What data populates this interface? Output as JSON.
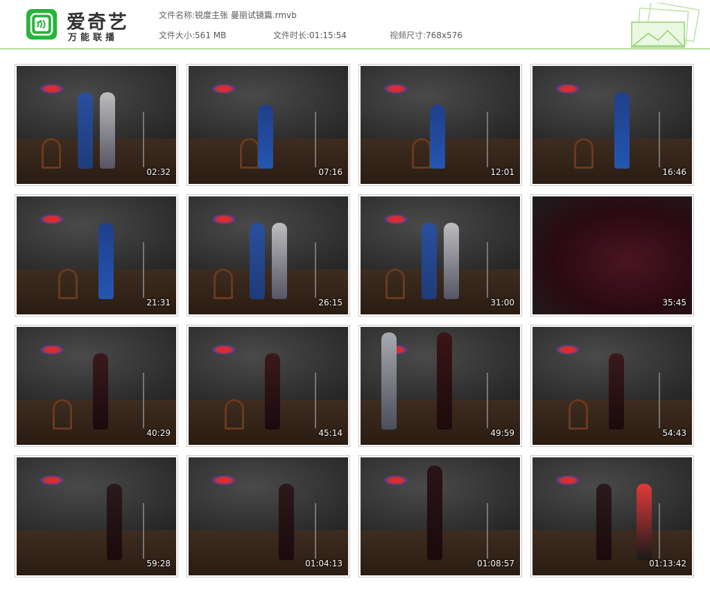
{
  "brand": {
    "title": "爱奇艺",
    "subtitle": "万能联播",
    "accent": "#27b43a"
  },
  "file_info": {
    "name_label": "文件名称:",
    "name_value": "锐度主张 曼丽试镜篇.rmvb",
    "size_label": "文件大小:",
    "size_value": "561 MB",
    "duration_label": "文件时长:",
    "duration_value": "01:15:54",
    "dims_label": "视频尺寸:",
    "dims_value": "768x576"
  },
  "thumbnails": [
    {
      "time": "02:32",
      "scene": "two-people"
    },
    {
      "time": "07:16",
      "scene": "chair"
    },
    {
      "time": "12:01",
      "scene": "chair"
    },
    {
      "time": "16:46",
      "scene": "standing-rope"
    },
    {
      "time": "21:31",
      "scene": "standing-rope"
    },
    {
      "time": "26:15",
      "scene": "two-people"
    },
    {
      "time": "31:00",
      "scene": "two-people"
    },
    {
      "time": "35:45",
      "scene": "close-up"
    },
    {
      "time": "40:29",
      "scene": "standing"
    },
    {
      "time": "45:14",
      "scene": "standing"
    },
    {
      "time": "49:59",
      "scene": "two-people-close"
    },
    {
      "time": "54:43",
      "scene": "standing"
    },
    {
      "time": "59:28",
      "scene": "ladder"
    },
    {
      "time": "01:04:13",
      "scene": "ladder"
    },
    {
      "time": "01:08:57",
      "scene": "ladder-close"
    },
    {
      "time": "01:13:42",
      "scene": "ladder-two"
    }
  ]
}
